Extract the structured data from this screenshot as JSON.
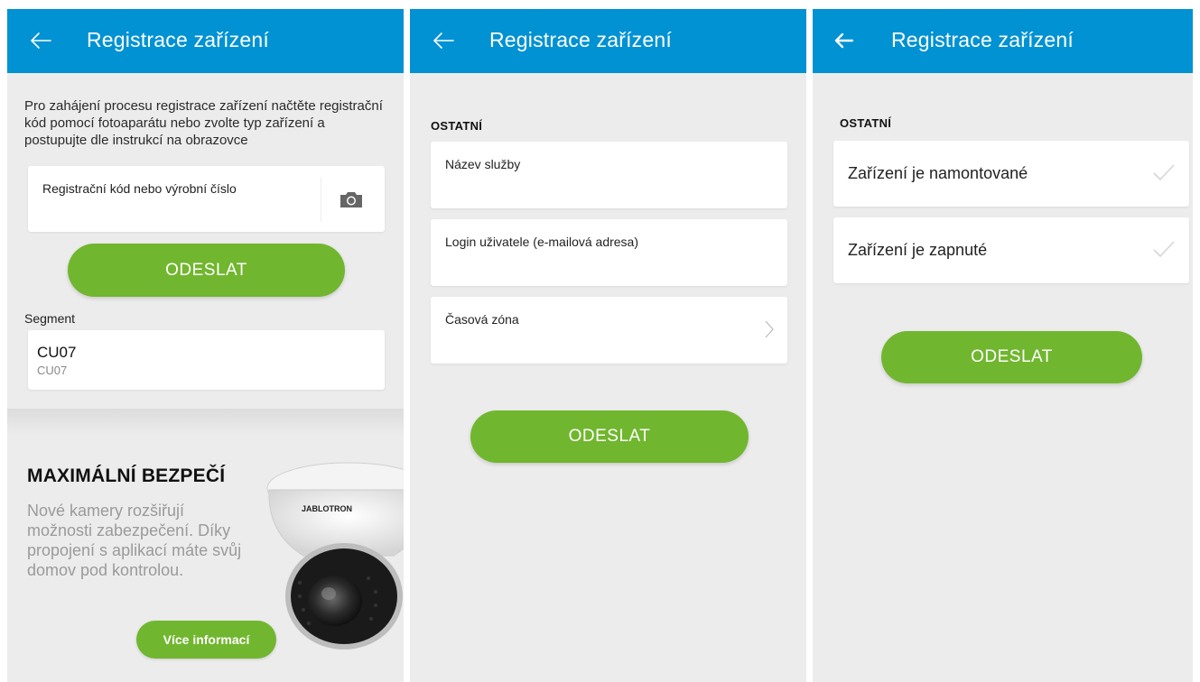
{
  "screens": {
    "registration": {
      "title": "Registrace zařízení",
      "intro": "Pro zahájení procesu registrace zařízení načtěte registrační kód pomocí fotoaparátu nebo zvolte typ zařízení a postupujte dle instrukcí na obrazovce",
      "code_label": "Registrační kód nebo výrobní číslo",
      "send_label": "ODESLAT",
      "segment_label": "Segment",
      "segment_value": "CU07",
      "segment_sub": "CU07",
      "promo": {
        "heading": "MAXIMÁLNÍ BEZPEČÍ",
        "body": "Nové kamery rozšiřují možnosti zabezpečení. Díky propojení s aplikací máte svůj domov pod kontrolou.",
        "button": "Více informací",
        "brand": "JABLOTRON"
      }
    },
    "service": {
      "title": "Registrace zařízení",
      "section": "OSTATNÍ",
      "fields": [
        "Název služby",
        "Login uživatele (e-mailová adresa)",
        "Časová zóna"
      ],
      "send_label": "ODESLAT"
    },
    "confirm": {
      "title": "Registrace zařízení",
      "section": "OSTATNÍ",
      "rows": [
        "Zařízení je namontované",
        "Zařízení je zapnuté"
      ],
      "send_label": "ODESLAT"
    }
  },
  "icons": {
    "back": "arrow-left-icon",
    "camera": "camera-icon",
    "chevron": "chevron-right-icon",
    "check": "check-icon"
  },
  "colors": {
    "appbar": "#0192d3",
    "accent_green": "#71b62f",
    "background": "#ececec"
  }
}
